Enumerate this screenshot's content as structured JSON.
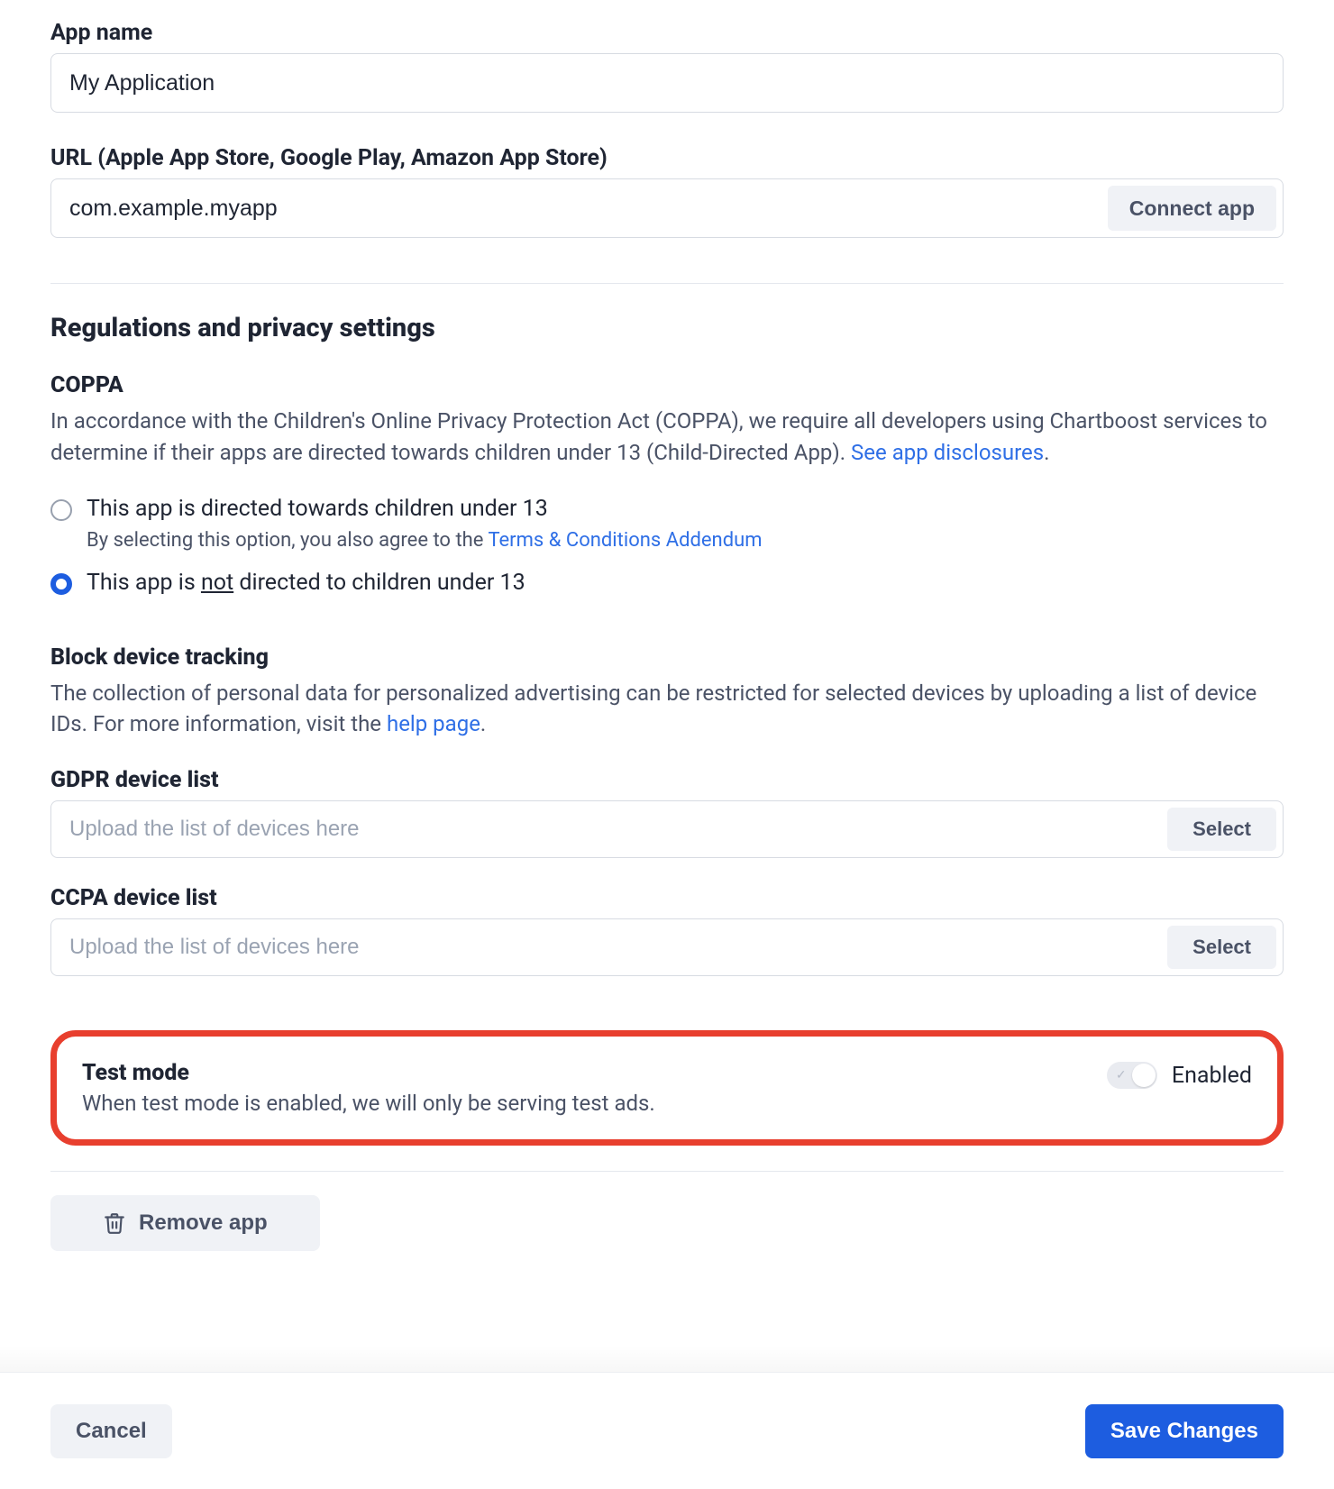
{
  "app_name": {
    "label": "App name",
    "value": "My Application"
  },
  "url": {
    "label": "URL (Apple App Store, Google Play, Amazon App Store)",
    "value": "com.example.myapp",
    "connect_button": "Connect app"
  },
  "regulations": {
    "title": "Regulations and privacy settings",
    "coppa": {
      "heading": "COPPA",
      "body_a": "In accordance with the Children's Online Privacy Protection Act (COPPA), we require all developers using Chartboost services to determine if their apps are directed towards children under 13 (Child-Directed App).  ",
      "disclosures_link": "See app disclosures",
      "period": ".",
      "option_directed": "This app is directed towards children under 13",
      "option_directed_sub_a": "By selecting this option, you also agree to the ",
      "option_directed_sub_link": "Terms & Conditions Addendum",
      "option_not_a": "This app is ",
      "option_not_underline": "not",
      "option_not_b": " directed to children under 13"
    },
    "block_tracking": {
      "heading": "Block device tracking",
      "body_a": "The collection of personal data for personalized advertising can be restricted for selected devices by uploading a list of device IDs. For more information, visit the ",
      "help_link": "help page",
      "period": "."
    },
    "gdpr": {
      "label": "GDPR device list",
      "placeholder": "Upload the list of devices here",
      "select": "Select"
    },
    "ccpa": {
      "label": "CCPA device list",
      "placeholder": "Upload the list of devices here",
      "select": "Select"
    }
  },
  "test_mode": {
    "title": "Test mode",
    "desc": "When test mode is enabled, we will only be serving test ads.",
    "status": "Enabled"
  },
  "remove_app": "Remove app",
  "footer": {
    "cancel": "Cancel",
    "save": "Save Changes"
  }
}
